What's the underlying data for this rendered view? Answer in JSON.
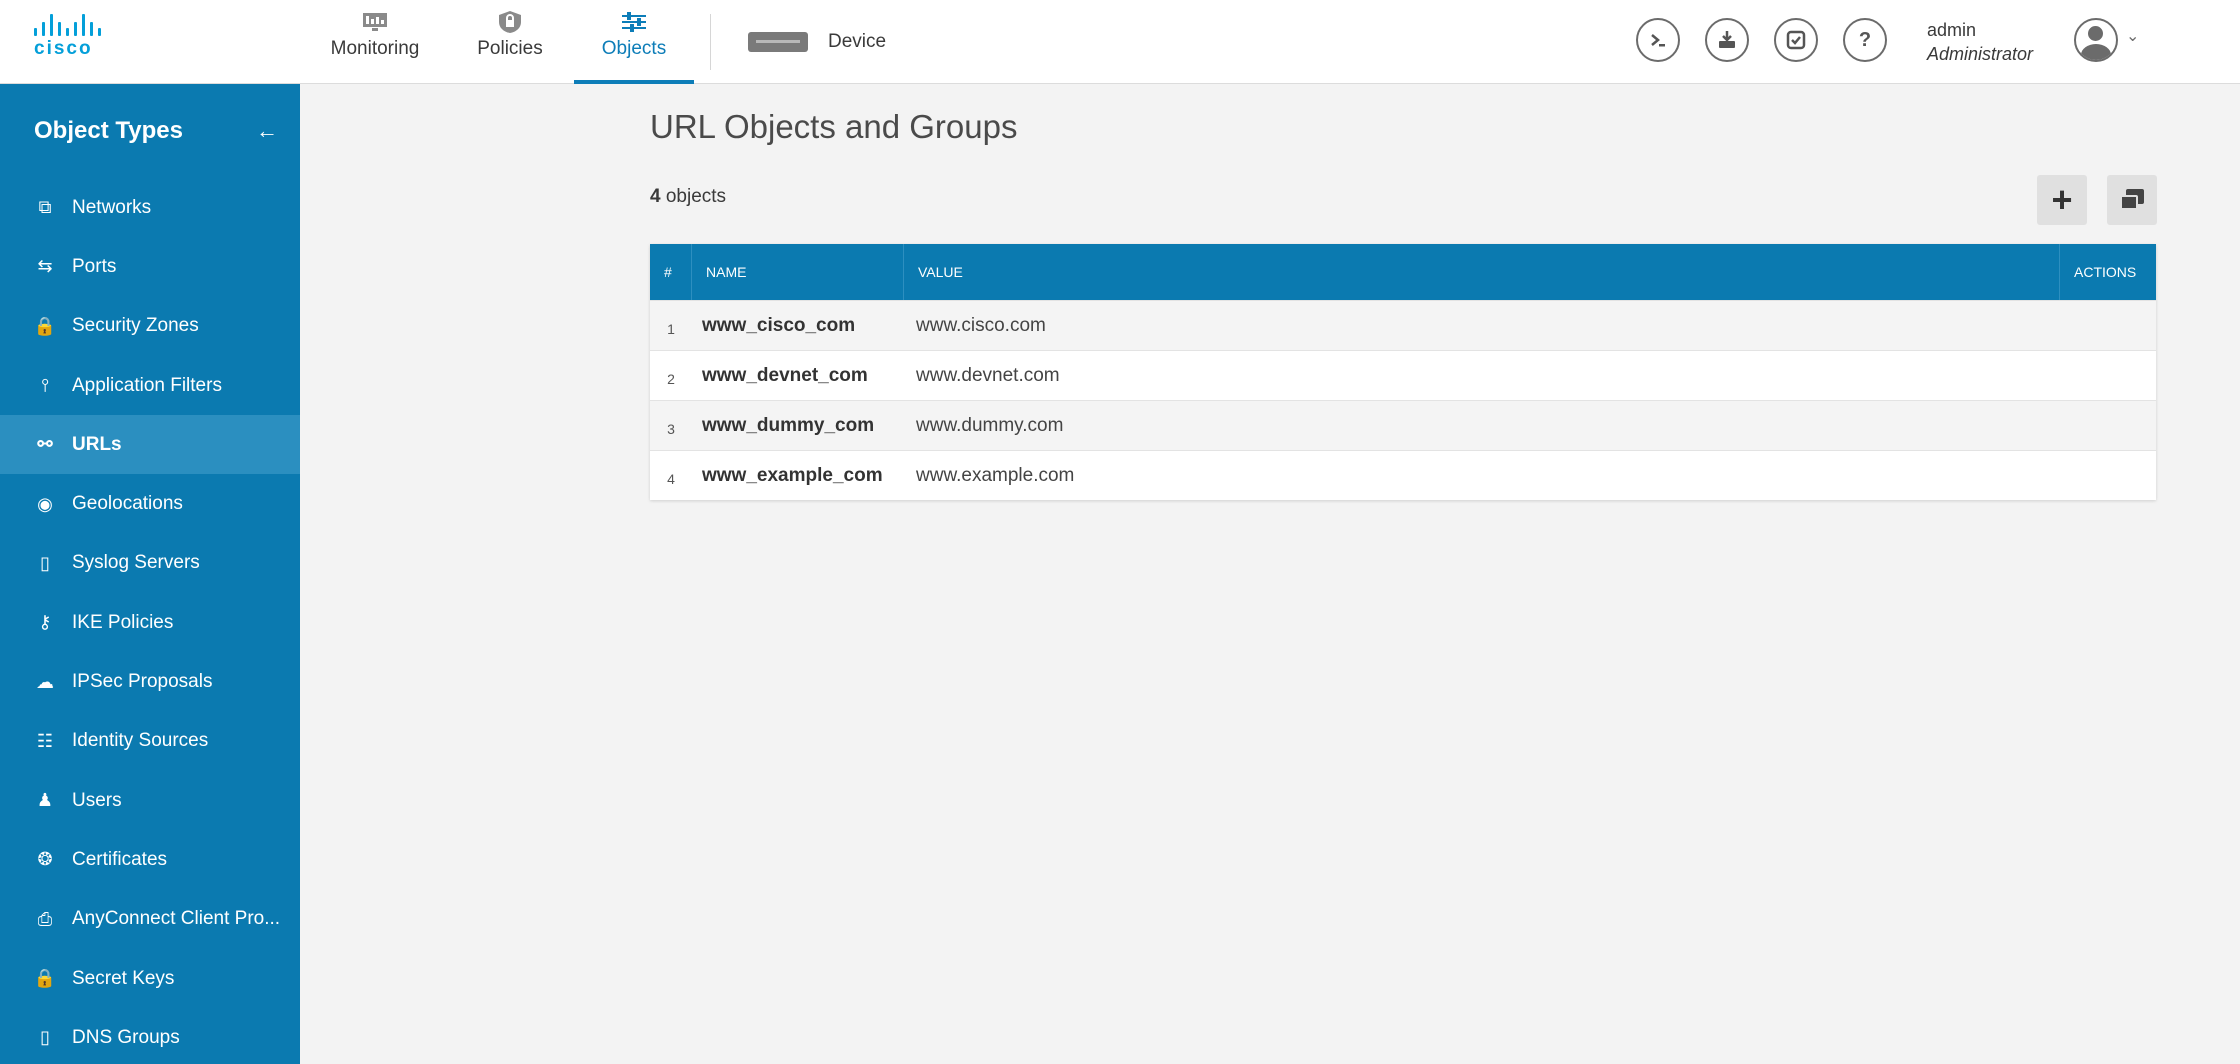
{
  "brand": {
    "name": "cisco"
  },
  "nav": {
    "tabs": [
      {
        "label": "Monitoring",
        "icon": "monitoring-icon"
      },
      {
        "label": "Policies",
        "icon": "policies-shield-icon"
      },
      {
        "label": "Objects",
        "icon": "objects-sliders-icon",
        "active": true
      }
    ],
    "device_label": "Device"
  },
  "header_tools": [
    {
      "icon": "cli-console-icon"
    },
    {
      "icon": "deploy-icon"
    },
    {
      "icon": "tasks-icon"
    },
    {
      "icon": "help-icon"
    }
  ],
  "user": {
    "name": "admin",
    "role": "Administrator"
  },
  "sidebar": {
    "title": "Object Types",
    "items": [
      {
        "label": "Networks",
        "icon": "networks-icon"
      },
      {
        "label": "Ports",
        "icon": "ports-icon"
      },
      {
        "label": "Security Zones",
        "icon": "lock-icon"
      },
      {
        "label": "Application Filters",
        "icon": "filter-icon"
      },
      {
        "label": "URLs",
        "icon": "link-icon",
        "active": true
      },
      {
        "label": "Geolocations",
        "icon": "location-pin-icon"
      },
      {
        "label": "Syslog Servers",
        "icon": "server-icon"
      },
      {
        "label": "IKE Policies",
        "icon": "key-icon"
      },
      {
        "label": "IPSec Proposals",
        "icon": "cloud-lock-icon"
      },
      {
        "label": "Identity Sources",
        "icon": "identity-source-icon"
      },
      {
        "label": "Users",
        "icon": "user-icon"
      },
      {
        "label": "Certificates",
        "icon": "certificate-icon"
      },
      {
        "label": "AnyConnect Client Pro...",
        "icon": "anyconnect-icon"
      },
      {
        "label": "Secret Keys",
        "icon": "lock-icon"
      },
      {
        "label": "DNS Groups",
        "icon": "server-icon"
      }
    ]
  },
  "main": {
    "title": "URL Objects and Groups",
    "count": "4",
    "count_suffix": " objects",
    "table": {
      "columns": [
        "#",
        "NAME",
        "VALUE",
        "ACTIONS"
      ],
      "rows": [
        {
          "num": "1",
          "name": "www_cisco_com",
          "value": "www.cisco.com"
        },
        {
          "num": "2",
          "name": "www_devnet_com",
          "value": "www.devnet.com"
        },
        {
          "num": "3",
          "name": "www_dummy_com",
          "value": "www.dummy.com"
        },
        {
          "num": "4",
          "name": "www_example_com",
          "value": "www.example.com"
        }
      ]
    }
  },
  "colors": {
    "accent": "#0b7ab0",
    "brand": "#049fd9",
    "active_tab": "#0d7db8"
  }
}
